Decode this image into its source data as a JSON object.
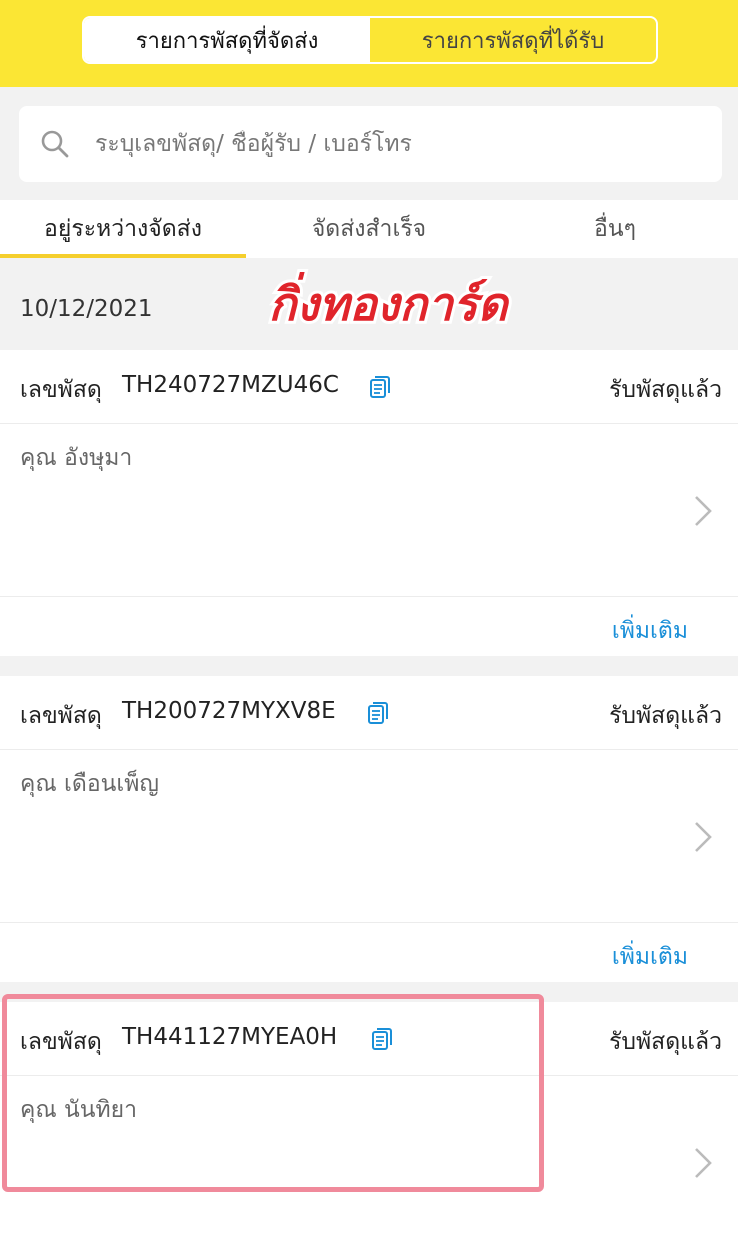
{
  "top_tabs": [
    "รายการพัสดุที่จัดส่ง",
    "รายการพัสดุที่ได้รับ"
  ],
  "search": {
    "placeholder": "ระบุเลขพัสดุ/ ชื่อผู้รับ / เบอร์โทร"
  },
  "status_tabs": [
    "อยู่ระหว่างจัดส่ง",
    "จัดส่งสำเร็จ",
    "อื่นๆ"
  ],
  "date_group": "10/12/2021",
  "watermark_text": "กิ่งทองการ์ด",
  "parcels": [
    {
      "label": "เลขพัสดุ",
      "number": "TH240727MZU46C",
      "status": "รับพัสดุแล้ว",
      "recipient": "คุณ อังษุมา",
      "more": "เพิ่มเติม"
    },
    {
      "label": "เลขพัสดุ",
      "number": "TH200727MYXV8E",
      "status": "รับพัสดุแล้ว",
      "recipient": "คุณ เดือนเพ็ญ",
      "more": "เพิ่มเติม"
    },
    {
      "label": "เลขพัสดุ",
      "number": "TH441127MYEA0H",
      "status": "รับพัสดุแล้ว",
      "recipient": "คุณ นันทิยา"
    }
  ],
  "colors": {
    "header_yellow": "#fbe634",
    "tab_underline": "#f5cf2d",
    "link_blue": "#1a8fd8",
    "highlight_pink": "#f08a9b"
  }
}
